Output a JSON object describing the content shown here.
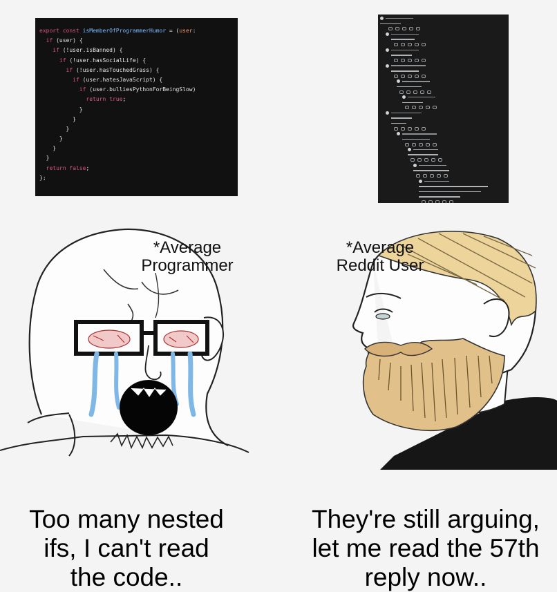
{
  "code": {
    "lines": [
      [
        {
          "c": "kw",
          "t": "export const "
        },
        {
          "c": "fn",
          "t": "isMemberOfProgrammerHumor"
        },
        {
          "c": "tx",
          "t": " = ("
        },
        {
          "c": "ty",
          "t": "user"
        },
        {
          "c": "tx",
          "t": ":"
        }
      ],
      [
        {
          "c": "tx",
          "t": "  "
        },
        {
          "c": "kw",
          "t": "if"
        },
        {
          "c": "tx",
          "t": " (user) {"
        }
      ],
      [
        {
          "c": "tx",
          "t": "    "
        },
        {
          "c": "kw",
          "t": "if"
        },
        {
          "c": "tx",
          "t": " (!user.isBanned) {"
        }
      ],
      [
        {
          "c": "tx",
          "t": "      "
        },
        {
          "c": "kw",
          "t": "if"
        },
        {
          "c": "tx",
          "t": " (!user.hasSocialLife) {"
        }
      ],
      [
        {
          "c": "tx",
          "t": "        "
        },
        {
          "c": "kw",
          "t": "if"
        },
        {
          "c": "tx",
          "t": " (!user.hasTouchedGrass) {"
        }
      ],
      [
        {
          "c": "tx",
          "t": "          "
        },
        {
          "c": "kw",
          "t": "if"
        },
        {
          "c": "tx",
          "t": " (user.hatesJavaScript) {"
        }
      ],
      [
        {
          "c": "tx",
          "t": "            "
        },
        {
          "c": "kw",
          "t": "if"
        },
        {
          "c": "tx",
          "t": " (user.bulliesPythonForBeingSlow)"
        }
      ],
      [
        {
          "c": "tx",
          "t": "              "
        },
        {
          "c": "kw",
          "t": "return"
        },
        {
          "c": "tx",
          "t": " "
        },
        {
          "c": "kw",
          "t": "true"
        },
        {
          "c": "tx",
          "t": ";"
        }
      ],
      [
        {
          "c": "tx",
          "t": "            }"
        }
      ],
      [
        {
          "c": "tx",
          "t": "          }"
        }
      ],
      [
        {
          "c": "tx",
          "t": "        }"
        }
      ],
      [
        {
          "c": "tx",
          "t": "      }"
        }
      ],
      [
        {
          "c": "tx",
          "t": "    }"
        }
      ],
      [
        {
          "c": "tx",
          "t": "  }"
        }
      ],
      [
        {
          "c": "tx",
          "t": "  "
        },
        {
          "c": "kw",
          "t": "return"
        },
        {
          "c": "tx",
          "t": " "
        },
        {
          "c": "kw",
          "t": "false"
        },
        {
          "c": "tx",
          "t": ";"
        }
      ],
      [
        {
          "c": "tx",
          "t": "};"
        }
      ]
    ]
  },
  "left_caption": "*Average\nProgrammer",
  "right_caption": "*Average\nReddit User",
  "left_bottom": "Too many nested\nifs, I can't read\nthe code..",
  "right_bottom": "They're still arguing,\nlet me read the 57th\nreply now..",
  "colors": {
    "code_bg": "#111112",
    "keyword": "#d9577c",
    "identifier": "#78b9ff",
    "thread_bg": "#1a1a1b",
    "beard": "#e2c08a",
    "hair": "#ecd49a",
    "tears": "#7fb8e6"
  }
}
